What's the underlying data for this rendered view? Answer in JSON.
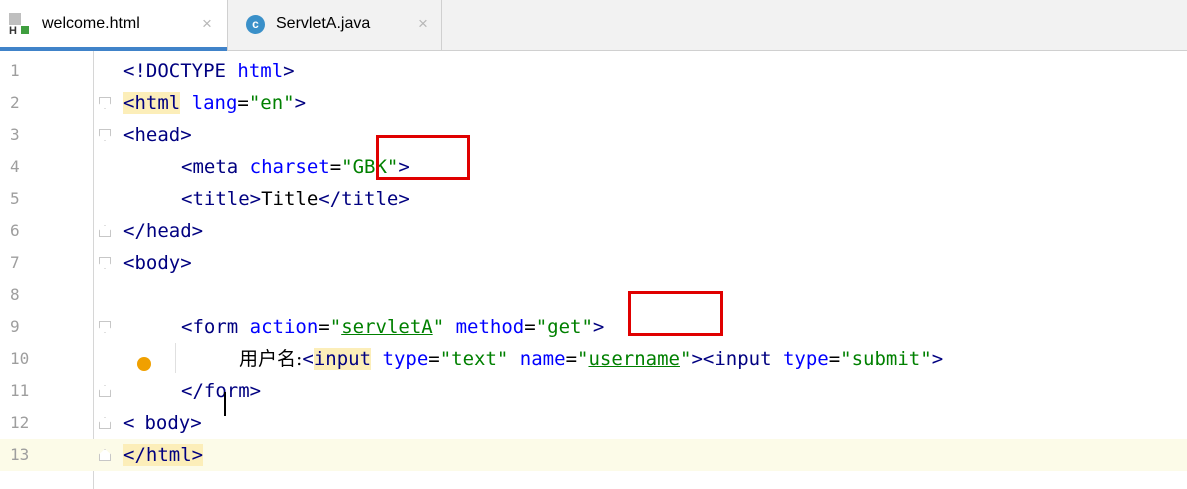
{
  "tabs": [
    {
      "label": "welcome.html",
      "icon": "html-file-icon",
      "active": true
    },
    {
      "label": "ServletA.java",
      "icon": "java-class-icon",
      "active": false
    }
  ],
  "tab_close_glyph": "×",
  "class_icon_letter": "c",
  "html_icon_letter": "H",
  "editor": {
    "line_numbers": [
      "1",
      "2",
      "3",
      "4",
      "5",
      "6",
      "7",
      "8",
      "9",
      "10",
      "11",
      "12",
      "13"
    ],
    "current_line": 13,
    "lines": {
      "l1": [
        "<!DOCTYPE ",
        "html",
        ">"
      ],
      "l2": [
        "<html",
        " lang",
        "=",
        "\"en\"",
        ">"
      ],
      "l3": [
        "<head>"
      ],
      "l4": [
        "<meta",
        " charset",
        "=",
        "\"GBK\"",
        ">"
      ],
      "l5": [
        "<title>",
        "Title",
        "</title>"
      ],
      "l6": [
        "</head>"
      ],
      "l7": [
        "<body>"
      ],
      "l9": [
        "<form",
        " action",
        "=",
        "\"",
        "servletA",
        "\"",
        " method",
        "=",
        "\"get\"",
        ">"
      ],
      "l10": [
        "用户名:",
        "<",
        "input",
        " type",
        "=",
        "\"text\"",
        " name",
        "=",
        "\"",
        "username",
        "\"",
        "><input",
        " type",
        "=",
        "\"submit\"",
        ">"
      ],
      "l11": [
        "</form>"
      ],
      "l12": [
        "<",
        "body>"
      ],
      "l13": [
        "</html>"
      ]
    }
  },
  "colors": {
    "accent": "#4083c9",
    "highlight_box": "#e00000",
    "tag": "#000080",
    "attribute": "#0000ff",
    "string": "#008000"
  }
}
